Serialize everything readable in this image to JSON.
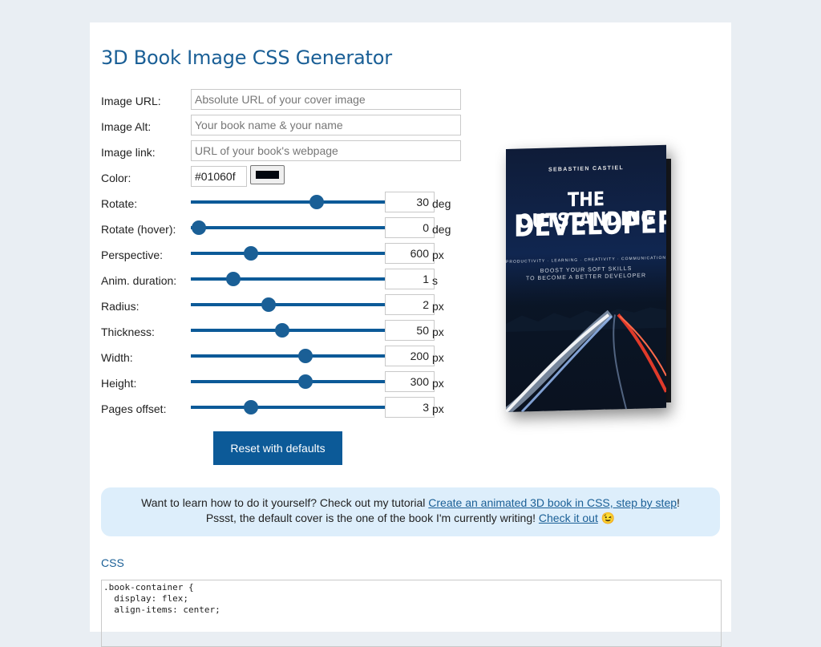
{
  "page": {
    "title": "3D Book Image CSS Generator"
  },
  "form": {
    "image_url": {
      "label": "Image URL:",
      "placeholder": "Absolute URL of your cover image"
    },
    "image_alt": {
      "label": "Image Alt:",
      "placeholder": "Your book name & your name"
    },
    "image_link": {
      "label": "Image link:",
      "placeholder": "URL of your book's webpage"
    },
    "color": {
      "label": "Color:",
      "value": "#01060f",
      "swatch": "#01060f"
    },
    "sliders": [
      {
        "label": "Rotate:",
        "value": "30",
        "unit": "deg",
        "fraction": 0.65
      },
      {
        "label": "Rotate (hover):",
        "value": "0",
        "unit": "deg",
        "fraction": 0.04
      },
      {
        "label": "Perspective:",
        "value": "600",
        "unit": "px",
        "fraction": 0.31
      },
      {
        "label": "Anim. duration:",
        "value": "1",
        "unit": "s",
        "fraction": 0.22
      },
      {
        "label": "Radius:",
        "value": "2",
        "unit": "px",
        "fraction": 0.4
      },
      {
        "label": "Thickness:",
        "value": "50",
        "unit": "px",
        "fraction": 0.47
      },
      {
        "label": "Width:",
        "value": "200",
        "unit": "px",
        "fraction": 0.59
      },
      {
        "label": "Height:",
        "value": "300",
        "unit": "px",
        "fraction": 0.59
      },
      {
        "label": "Pages offset:",
        "value": "3",
        "unit": "px",
        "fraction": 0.31
      }
    ],
    "reset_label": "Reset with defaults"
  },
  "book_preview": {
    "author": "SEBASTIEN CASTIEL",
    "title_line1": "THE OUTSTANDING",
    "title_line2": "DEVELOPER",
    "tagline": "PRODUCTIVITY · LEARNING · CREATIVITY · COMMUNICATION",
    "subtitle_line1": "BOOST YOUR SOFT SKILLS",
    "subtitle_line2": "TO BECOME A BETTER DEVELOPER"
  },
  "note": {
    "line1_prefix": "Want to learn how to do it yourself? Check out my tutorial ",
    "line1_link": "Create an animated 3D book in CSS, step by step",
    "line1_suffix": "!",
    "line2_prefix": "Pssst, the default cover is the one of the book I'm currently writing! ",
    "line2_link": "Check it out",
    "line2_emoji": "😉"
  },
  "css_section": {
    "heading": "CSS",
    "code": ".book-container {\n  display: flex;\n  align-items: center;"
  }
}
